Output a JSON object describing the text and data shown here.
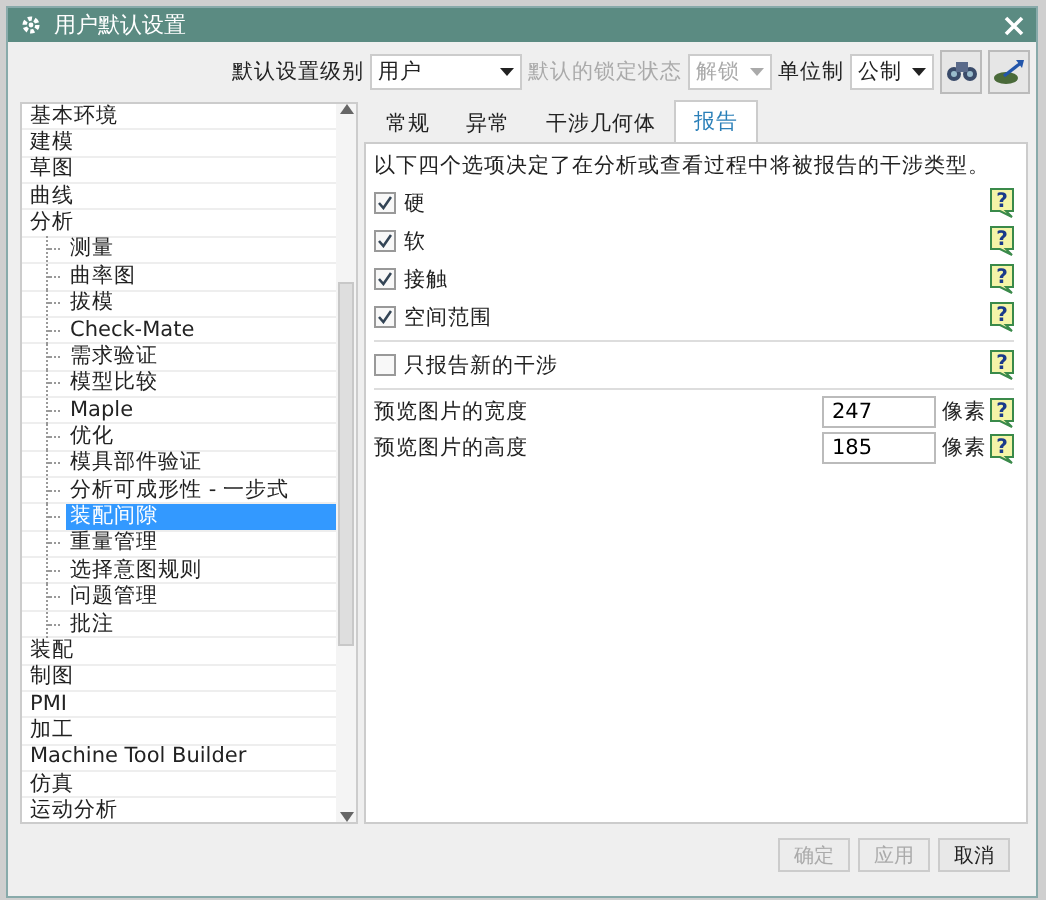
{
  "window": {
    "title": "用户默认设置"
  },
  "toolbar": {
    "fields": [
      {
        "label": "默认设置级别",
        "value": "用户",
        "disabled": false,
        "kind": "wide"
      },
      {
        "label": "默认的锁定状态",
        "value": "解锁",
        "disabled": true,
        "kind": "narrow"
      },
      {
        "label": "单位制",
        "value": "公制",
        "disabled": false,
        "kind": "narrow"
      }
    ]
  },
  "tree": {
    "items": [
      {
        "label": "基本环境",
        "selected": false
      },
      {
        "label": "建模",
        "selected": false
      },
      {
        "label": "草图",
        "selected": false
      },
      {
        "label": "曲线",
        "selected": false
      },
      {
        "label": "分析",
        "selected": false,
        "children": [
          {
            "label": "测量",
            "selected": false
          },
          {
            "label": "曲率图",
            "selected": false
          },
          {
            "label": "拔模",
            "selected": false
          },
          {
            "label": "Check-Mate",
            "selected": false
          },
          {
            "label": "需求验证",
            "selected": false
          },
          {
            "label": "模型比较",
            "selected": false
          },
          {
            "label": "Maple",
            "selected": false
          },
          {
            "label": "优化",
            "selected": false
          },
          {
            "label": "模具部件验证",
            "selected": false
          },
          {
            "label": "分析可成形性 - 一步式",
            "selected": false
          },
          {
            "label": "装配间隙",
            "selected": true
          },
          {
            "label": "重量管理",
            "selected": false
          },
          {
            "label": "选择意图规则",
            "selected": false
          },
          {
            "label": "问题管理",
            "selected": false
          },
          {
            "label": "批注",
            "selected": false
          }
        ]
      },
      {
        "label": "装配",
        "selected": false
      },
      {
        "label": "制图",
        "selected": false
      },
      {
        "label": "PMI",
        "selected": false
      },
      {
        "label": "加工",
        "selected": false
      },
      {
        "label": "Machine Tool Builder",
        "selected": false
      },
      {
        "label": "仿真",
        "selected": false
      },
      {
        "label": "运动分析",
        "selected": false
      }
    ]
  },
  "tabs": [
    {
      "label": "常规",
      "selected": false
    },
    {
      "label": "异常",
      "selected": false
    },
    {
      "label": "干涉几何体",
      "selected": false
    },
    {
      "label": "报告",
      "selected": true
    }
  ],
  "report": {
    "description": "以下四个选项决定了在分析或查看过程中将被报告的干涉类型。",
    "options": [
      {
        "label": "硬",
        "checked": true,
        "help": "?"
      },
      {
        "label": "软",
        "checked": true,
        "help": "?"
      },
      {
        "label": "接触",
        "checked": true,
        "help": "?"
      },
      {
        "label": "空间范围",
        "checked": true,
        "help": "?"
      }
    ],
    "only_new": {
      "label": "只报告新的干涉",
      "checked": false,
      "help": "?"
    },
    "sizes": [
      {
        "label": "预览图片的宽度",
        "value": "247",
        "unit": "像素",
        "help": "?"
      },
      {
        "label": "预览图片的高度",
        "value": "185",
        "unit": "像素",
        "help": "?"
      }
    ]
  },
  "buttons": [
    {
      "label": "确定",
      "disabled": true
    },
    {
      "label": "应用",
      "disabled": true
    },
    {
      "label": "取消",
      "disabled": false
    }
  ]
}
